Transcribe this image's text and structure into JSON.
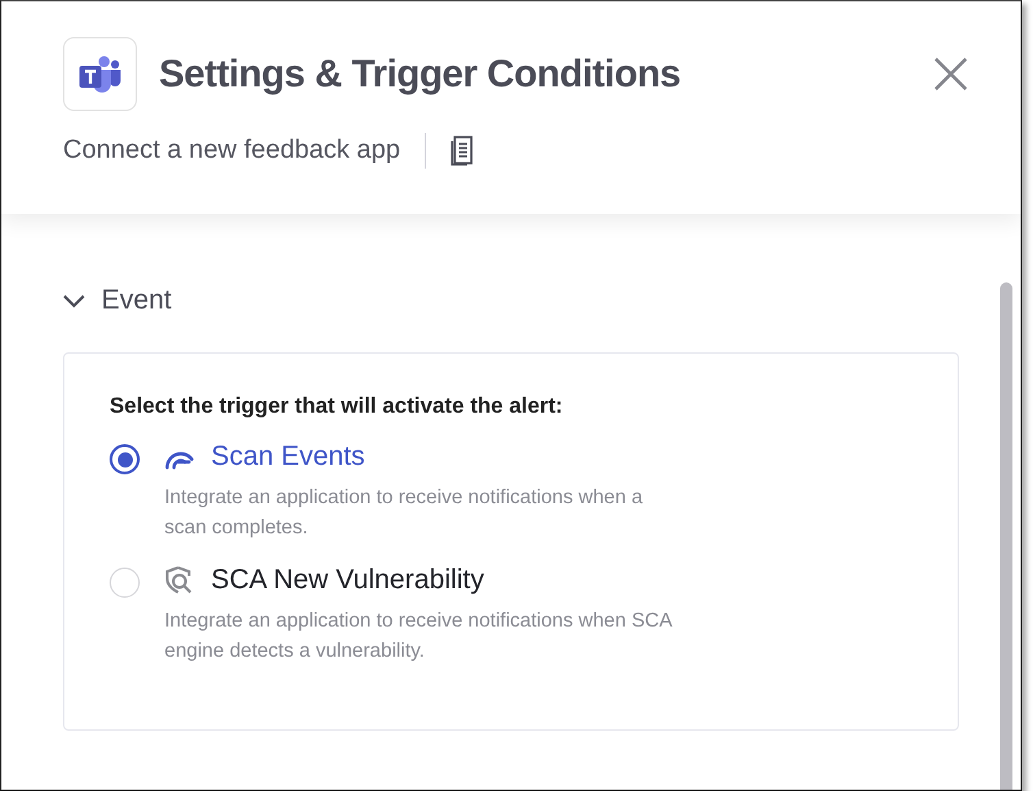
{
  "dialog": {
    "title": "Settings & Trigger Conditions",
    "subtitle": "Connect a new feedback app"
  },
  "section": {
    "label": "Event",
    "expanded": true
  },
  "prompt": "Select the trigger that will activate the alert:",
  "options": [
    {
      "kind": "scan",
      "title": "Scan Events",
      "description": "Integrate an application to receive notifications when a scan completes.",
      "selected": true
    },
    {
      "kind": "sca",
      "title": "SCA New Vulnerability",
      "description": "Integrate an application to receive notifications when SCA engine detects a vulnerability.",
      "selected": false
    }
  ]
}
